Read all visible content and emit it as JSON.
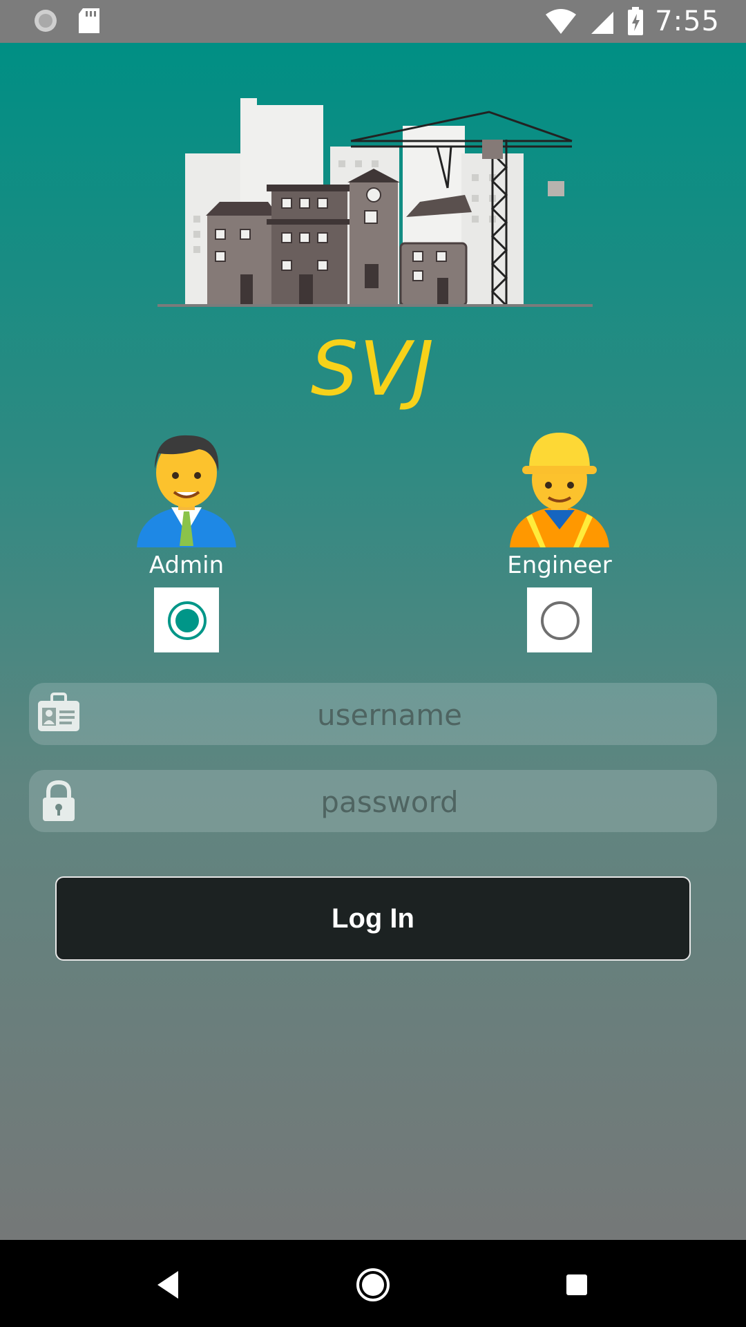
{
  "status_bar": {
    "time": "7:55"
  },
  "app": {
    "brand": "SVJ"
  },
  "roles": [
    {
      "label": "Admin",
      "selected": true
    },
    {
      "label": "Engineer",
      "selected": false
    }
  ],
  "fields": {
    "username_placeholder": "username",
    "password_placeholder": "password"
  },
  "login": {
    "label": "Log In"
  },
  "colors": {
    "accent": "#009688",
    "brand": "#f7d21a",
    "button": "#1c2222"
  },
  "icons": {
    "username": "id-card-icon",
    "password": "lock-icon"
  }
}
